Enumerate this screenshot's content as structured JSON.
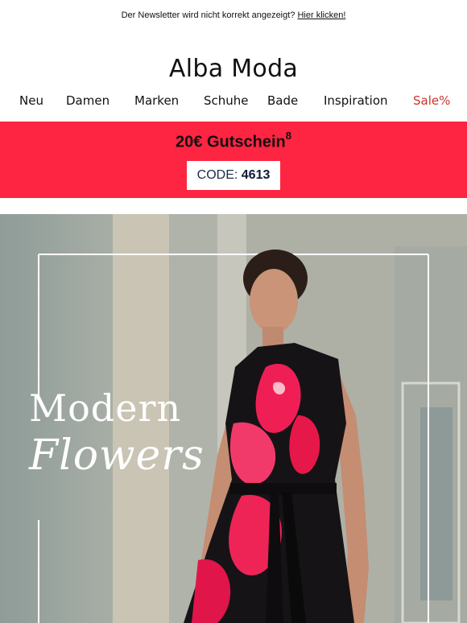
{
  "preheader": {
    "text": "Der Newsletter wird nicht korrekt angezeigt?",
    "link": "Hier klicken!"
  },
  "brand": {
    "logo": "Alba Moda"
  },
  "nav": {
    "items": [
      {
        "label": "Neu"
      },
      {
        "label": "Damen"
      },
      {
        "label": "Marken"
      },
      {
        "label": "Schuhe"
      },
      {
        "label": "Bade"
      },
      {
        "label": "Inspiration"
      },
      {
        "label": "Sale%"
      }
    ]
  },
  "promo": {
    "title": "20€ Gutschein",
    "footnote": "8",
    "code_label": "CODE:",
    "code_value": "4613"
  },
  "hero": {
    "line1": "Modern",
    "line2": "Flowers"
  },
  "colors": {
    "banner": "#fd2541",
    "sale": "#c8342d"
  }
}
